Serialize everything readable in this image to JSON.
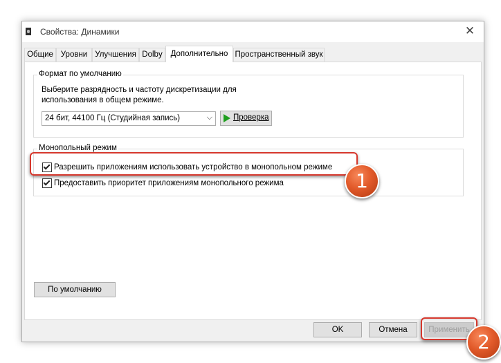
{
  "window": {
    "title": "Свойства: Динамики",
    "close_glyph": "✕"
  },
  "tabs": [
    {
      "label": "Общие",
      "active": false
    },
    {
      "label": "Уровни",
      "active": false
    },
    {
      "label": "Улучшения",
      "active": false
    },
    {
      "label": "Dolby",
      "active": false
    },
    {
      "label": "Дополнительно",
      "active": true
    },
    {
      "label": "Пространственный звук",
      "active": false
    }
  ],
  "default_format": {
    "group_label": "Формат по умолчанию",
    "description": "Выберите разрядность и частоту дискретизации для использования в общем режиме.",
    "selected_value": "24 бит, 44100 Гц (Студийная запись)",
    "test_button_label": "Проверка"
  },
  "exclusive_mode": {
    "group_label": "Монопольный режим",
    "checkbox1": {
      "label": "Разрешить приложениям использовать устройство в монопольном режиме",
      "checked": true
    },
    "checkbox2": {
      "label": "Предоставить приоритет приложениям монопольного режима",
      "checked": true
    }
  },
  "restore_defaults_label": "По умолчанию",
  "footer": {
    "ok_label": "OK",
    "cancel_label": "Отмена",
    "apply_label": "Применить",
    "apply_enabled": false
  },
  "annotations": {
    "marker1": "1",
    "marker2": "2",
    "accent_color": "#d6372c",
    "marker_color": "#e25a2a"
  },
  "icons": {
    "app": "speaker-icon",
    "play": "play-icon",
    "dropdown": "chevron-down-icon"
  }
}
